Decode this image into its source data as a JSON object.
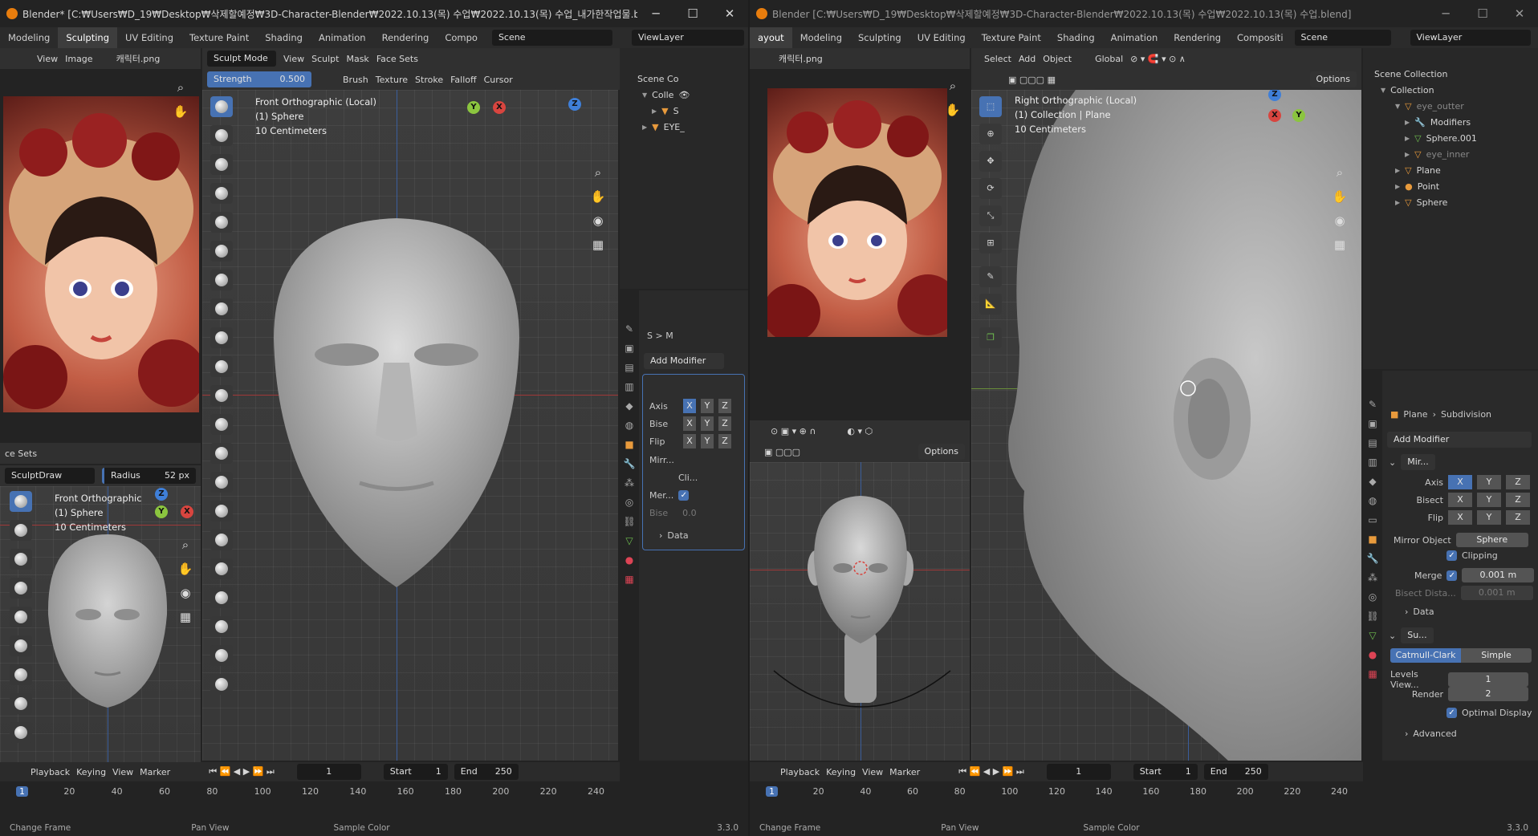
{
  "left": {
    "title": "Blender* [C:₩Users₩D_19₩Desktop₩삭제할예정₩3D-Character-Blender₩2022.10.13(목) 수업₩2022.10.13(목) 수업_내가한작업물.blend]",
    "workspaces": [
      "Modeling",
      "Sculpting",
      "UV Editing",
      "Texture Paint",
      "Shading",
      "Animation",
      "Rendering",
      "Compo"
    ],
    "scene": "Scene",
    "viewlayer": "ViewLayer",
    "img_header": {
      "view": "View",
      "image": "Image",
      "file": "캐릭터.png"
    },
    "sculpt_header": {
      "mode": "Sculpt Mode",
      "menus": [
        "View",
        "Sculpt",
        "Mask",
        "Face Sets"
      ]
    },
    "tool_settings": {
      "strength_label": "Strength",
      "strength_value": "0.500",
      "brush": "Brush",
      "texture": "Texture",
      "stroke": "Stroke",
      "falloff": "Falloff",
      "cursor": "Cursor"
    },
    "main_vp": {
      "view": "Front Orthographic (Local)",
      "object": "(1) Sphere",
      "scale": "10 Centimeters"
    },
    "small_header": {
      "facesets": "ce Sets",
      "brush": "SculptDraw",
      "radius_label": "Radius",
      "radius_value": "52 px"
    },
    "small_vp": {
      "view": "Front Orthographic",
      "object": "(1) Sphere",
      "scale": "10 Centimeters"
    },
    "outliner": {
      "scene_coll": "Scene Co",
      "coll": "Colle",
      "items": [
        "S",
        "EYE_"
      ]
    },
    "modifier": {
      "breadcrumb": "S  >  M",
      "add_modifier": "Add Modifier",
      "axis": "Axis",
      "bisect": "Bise",
      "flip": "Flip",
      "mirror": "Mirr...",
      "clipping": "Cli...",
      "merge": "Mer...",
      "bisect_dist": "Bise",
      "bisect_val": "0.0",
      "data": "Data"
    },
    "timeline": {
      "playback": "Playback",
      "keying": "Keying",
      "view": "View",
      "marker": "Marker",
      "frame": "1",
      "start_label": "Start",
      "start": "1",
      "end_label": "End",
      "end": "250",
      "ticks": [
        "1",
        "20",
        "40",
        "60",
        "80",
        "100",
        "120",
        "140",
        "160",
        "180",
        "200",
        "220",
        "240"
      ]
    },
    "status": [
      "Change Frame",
      "Pan View",
      "Sample Color"
    ],
    "version": "3.3.0"
  },
  "right": {
    "title": "Blender [C:₩Users₩D_19₩Desktop₩삭제할예정₩3D-Character-Blender₩2022.10.13(목) 수업₩2022.10.13(목) 수업.blend]",
    "workspaces": [
      "ayout",
      "Modeling",
      "Sculpting",
      "UV Editing",
      "Texture Paint",
      "Shading",
      "Animation",
      "Rendering",
      "Compositi"
    ],
    "scene": "Scene",
    "viewlayer": "ViewLayer",
    "img_file": "캐릭터.png",
    "vp_header": {
      "menus": [
        "Select",
        "Add",
        "Object"
      ],
      "orient": "Global",
      "options": "Options"
    },
    "main_vp": {
      "view": "Right Orthographic (Local)",
      "object": "(1) Collection | Plane",
      "scale": "10 Centimeters"
    },
    "small_options": "Options",
    "outliner": {
      "scene_coll": "Scene Collection",
      "collection": "Collection",
      "items": [
        "eye_outter",
        "Modifiers",
        "Sphere.001",
        "eye_inner",
        "Plane",
        "Point",
        "Sphere"
      ]
    },
    "props": {
      "object": "Plane",
      "modifier": "Subdivision",
      "add_modifier": "Add Modifier",
      "mirror_name": "Mir...",
      "axis": "Axis",
      "bisect": "Bisect",
      "flip": "Flip",
      "mirror_object_label": "Mirror Object",
      "mirror_object": "Sphere",
      "clipping": "Clipping",
      "merge_label": "Merge",
      "merge_value": "0.001 m",
      "bisect_dist_label": "Bisect Dista...",
      "bisect_dist": "0.001 m",
      "data": "Data",
      "subsurf_name": "Su...",
      "catmull": "Catmull-Clark",
      "simple": "Simple",
      "levels_label": "Levels View...",
      "levels": "1",
      "render_label": "Render",
      "render": "2",
      "optimal": "Optimal Display",
      "advanced": "Advanced"
    },
    "timeline": {
      "playback": "Playback",
      "keying": "Keying",
      "view": "View",
      "marker": "Marker",
      "frame": "1",
      "start_label": "Start",
      "start": "1",
      "end_label": "End",
      "end": "250",
      "ticks": [
        "1",
        "20",
        "40",
        "60",
        "80",
        "100",
        "120",
        "140",
        "160",
        "180",
        "200",
        "220",
        "240"
      ]
    },
    "status": [
      "Change Frame",
      "Pan View",
      "Sample Color"
    ],
    "version": "3.3.0"
  },
  "axes": {
    "x": "X",
    "y": "Y",
    "z": "Z"
  },
  "colors": {
    "accent": "#4772b3",
    "x_axis": "#d8453f",
    "y_axis": "#8bc53f",
    "z_axis": "#3f7fd8",
    "logo": "#e87d0d"
  }
}
